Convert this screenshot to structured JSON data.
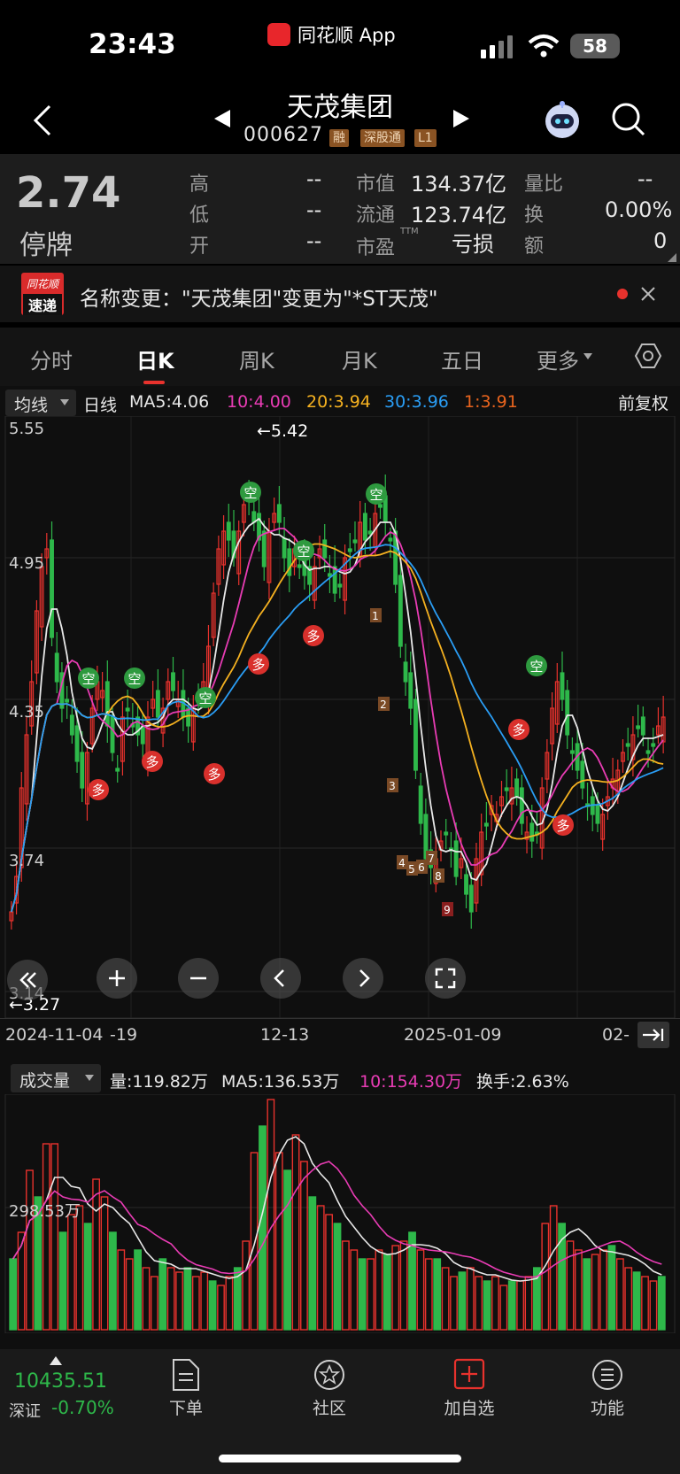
{
  "status_bar": {
    "time": "23:43",
    "app": "同花顺 App",
    "battery": "58"
  },
  "header": {
    "title": "天茂集团",
    "code": "000627",
    "tags": [
      "融",
      "深股通",
      "L1"
    ]
  },
  "quote": {
    "price": "2.74",
    "status": "停牌",
    "rows": [
      {
        "l1": "高",
        "v1": "--",
        "l2": "市值",
        "v2": "134.37亿",
        "l3": "量比",
        "v3": "--"
      },
      {
        "l1": "低",
        "v1": "--",
        "l2": "流通",
        "v2": "123.74亿",
        "l3": "换",
        "v3": "0.00%"
      },
      {
        "l1": "开",
        "v1": "--",
        "l2": "市盈",
        "sup": "TTM",
        "v2": "亏损",
        "l3": "额",
        "v3": "0"
      }
    ]
  },
  "news": {
    "logo_top": "同花顺",
    "logo_bottom": "速递",
    "text": "名称变更：\"天茂集团\"变更为\"*ST天茂\""
  },
  "tabs": [
    "分时",
    "日K",
    "周K",
    "月K",
    "五日",
    "更多"
  ],
  "active_tab": "日K",
  "kline": {
    "ma_selector": "均线",
    "period": "日线",
    "ma": [
      {
        "label": "MA5:4.06",
        "color": "#e8e8e8"
      },
      {
        "label": "10:4.00",
        "color": "#e83cb4"
      },
      {
        "label": "20:3.94",
        "color": "#f5b120"
      },
      {
        "label": "30:3.96",
        "color": "#2a9df4"
      },
      {
        "label": "1:3.91",
        "color": "#e8641e"
      }
    ],
    "adjust": "前复权",
    "y_labels": [
      "5.55",
      "4.95",
      "4.35",
      "3.74",
      "3.14"
    ],
    "high_marker": "←5.42",
    "low_marker": "←3.27",
    "dates": [
      "2024-11-04",
      "-19",
      "12-13",
      "2025-01-09",
      "02-"
    ]
  },
  "volume": {
    "selector": "成交量",
    "vol": "量:119.82万",
    "ma5": "MA5:136.53万",
    "ma10": "10:154.30万",
    "turnover": "换手:2.63%",
    "axis_label": "298.53万"
  },
  "bottom": {
    "index_value": "10435.51",
    "index_name": "深证",
    "index_change": "-0.70%",
    "items": [
      "下单",
      "社区",
      "加自选",
      "功能"
    ]
  },
  "colors": {
    "up": "#e8322d",
    "down": "#2eb84a",
    "accent": "#e8322d"
  }
}
